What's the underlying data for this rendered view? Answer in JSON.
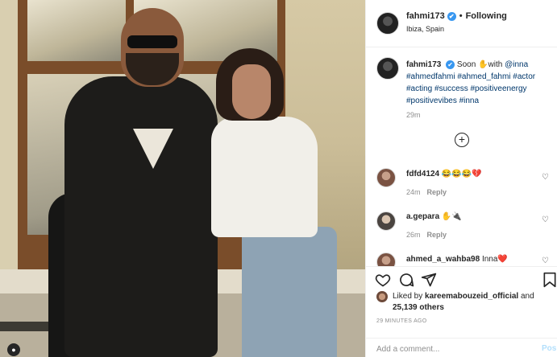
{
  "header": {
    "username": "fahmi173",
    "verified_mark": "✔",
    "separator": "•",
    "follow_status": "Following",
    "location": "Ibiza, Spain"
  },
  "caption": {
    "username": "fahmi173",
    "text_prefix": "Soon ",
    "emoji": "✋",
    "text_with": "with ",
    "mention": "@inna",
    "hashtags": "#ahmedfahmi #ahmed_fahmi #actor #acting #success #positiveenergy #positivevibes #inna",
    "time": "29m"
  },
  "more_comments_icon": "plus-circle-icon",
  "more_comments_symbol": "+",
  "comments": [
    {
      "username": "fdfd4124",
      "text": "😂😂😂💔",
      "time": "24m",
      "reply": "Reply"
    },
    {
      "username": "a.gepara",
      "text": "✋🔌",
      "time": "26m",
      "reply": "Reply"
    },
    {
      "username": "ahmed_a_wahba98",
      "text": "Inna❤️",
      "time": "",
      "reply": ""
    }
  ],
  "actions": {
    "like_icon": "heart-icon",
    "comment_icon": "comment-bubble-icon",
    "share_icon": "paper-plane-icon",
    "save_icon": "bookmark-icon"
  },
  "likes": {
    "prefix": "Liked by ",
    "user": "kareemabouzeid_official",
    "conjunction": " and",
    "count": "25,139 others"
  },
  "posted": "29 MINUTES AGO",
  "add_comment": {
    "placeholder": "Add a comment...",
    "post_label": "Pos"
  },
  "colors": {
    "link": "#00376b",
    "verified": "#3897f0",
    "muted": "#8e8e8e",
    "post_disabled": "#b2dffc"
  }
}
